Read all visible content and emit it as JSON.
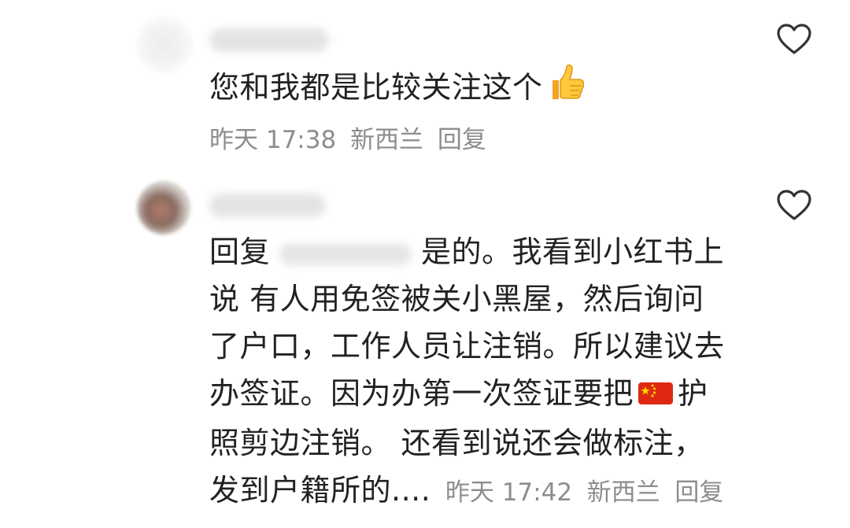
{
  "comments": [
    {
      "text": "您和我都是比较关注这个",
      "emoji": "thumbs-up-icon",
      "time": "昨天 17:38",
      "location": "新西兰",
      "reply_label": "回复"
    },
    {
      "reply_prefix": "回复",
      "lines": [
        "是的。我看到小红书上",
        "说 有人用免签被关小黑屋，然后询问",
        "了户口，工作人员让注销。所以建议去",
        "办签证。因为办第一次签证要把",
        "护",
        "照剪边注销。 还看到说还会做标注，",
        "发到户籍所的...."
      ],
      "flag_emoji": "china-flag-icon",
      "time": "昨天 17:42",
      "location": "新西兰",
      "reply_label": "回复"
    }
  ],
  "colors": {
    "text": "#222222",
    "meta": "#8d8d8d",
    "icon": "#333333"
  }
}
